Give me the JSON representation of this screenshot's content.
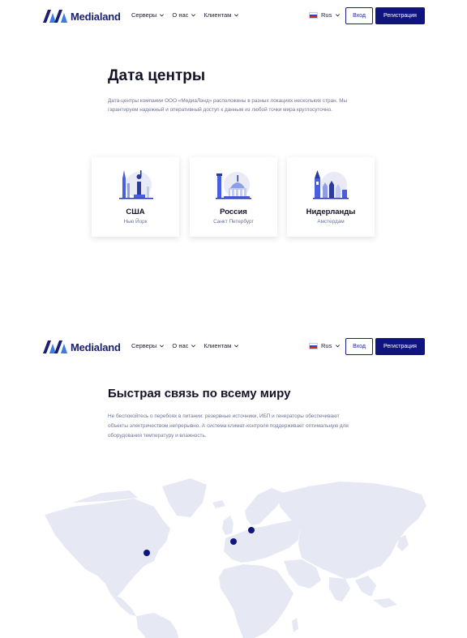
{
  "header": {
    "logo_text": "Medialand",
    "nav": [
      {
        "label": "Серверы"
      },
      {
        "label": "О нас"
      },
      {
        "label": "Клиентам"
      }
    ],
    "language": "Rus",
    "login_label": "Вход",
    "register_label": "Регистрация"
  },
  "datacenters": {
    "title": "Дата центры",
    "description": "Дата-центры компании ООО «МедиаЛэнд» расположены в разных локациях нескольких стран. Мы гарантируем надежный и оперативный доступ к данным из любой точки мира круглосуточно.",
    "cards": [
      {
        "country": "США",
        "city": "Нью Йорк"
      },
      {
        "country": "Россия",
        "city": "Санкт Петербург"
      },
      {
        "country": "Нидерланды",
        "city": "Амстердам"
      }
    ]
  },
  "connectivity": {
    "title": "Быстрая связь по всему миру",
    "description": "Не беспокойтесь о перебоях в питании: резервные источники, ИБП и генераторы обеспечивают объекты электричеством непрерывно. А система климат-контроля поддерживает оптимальную для оборудования температуру и влажность."
  },
  "colors": {
    "brand": "#10157d",
    "logo_light": "#3c7be0",
    "map_land": "#e6e8f4",
    "marker": "#10157d",
    "illustration_accent": "#4a5fe0"
  },
  "icons": [
    "chevron-down-icon",
    "russia-flag-icon",
    "medialand-logo-icon",
    "usa-landmark-illustration",
    "russia-landmark-illustration",
    "netherlands-landmark-illustration",
    "world-map"
  ]
}
